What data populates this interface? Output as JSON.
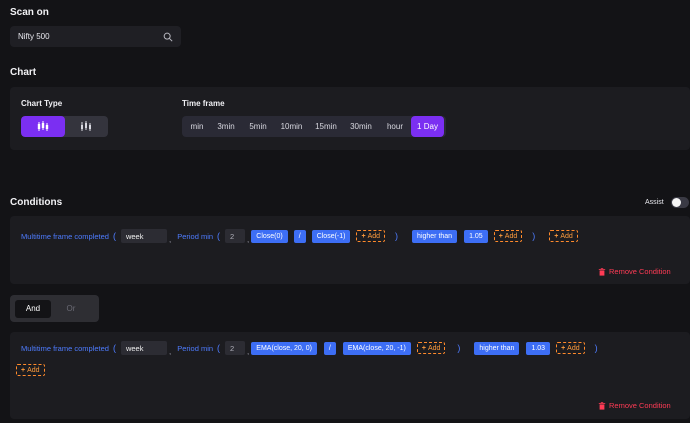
{
  "scan": {
    "title": "Scan on",
    "value": "Nifty 500"
  },
  "chart": {
    "title": "Chart",
    "chart_type_label": "Chart Type",
    "chart_types": [
      "candlestick",
      "ohlc-bar"
    ],
    "active_chart_type": "candlestick",
    "timeframe_label": "Time frame",
    "timeframes": [
      "min",
      "3min",
      "5min",
      "10min",
      "15min",
      "30min",
      "hour",
      "1 Day"
    ],
    "active_timeframe": "1 Day"
  },
  "conditions": {
    "title": "Conditions",
    "assist_label": "Assist",
    "assist_on": false,
    "remove_label": "Remove Condition",
    "add_label": "Add",
    "condition_1": {
      "link": "Multitime frame completed",
      "timeframe": "week",
      "period_link": "Period min",
      "period": "2",
      "lhs": "Close(0)",
      "op": "/",
      "rhs": "Close(-1)",
      "compare": "higher than",
      "value": "1.05"
    },
    "condition_2": {
      "link": "Multitime frame completed",
      "timeframe": "week",
      "period_link": "Period min",
      "period": "2",
      "lhs": "EMA(close, 20, 0)",
      "op": "/",
      "rhs": "EMA(close, 20, -1)",
      "compare": "higher than",
      "value": "1.03"
    },
    "logic": {
      "and_label": "And",
      "or_label": "Or",
      "active": "And"
    }
  },
  "colors": {
    "background": "#131316",
    "panel": "#1c1c20",
    "accent": "#7b2ff2",
    "link": "#4e7cff",
    "pill": "#3d6ef5",
    "add": "#ff8a2b",
    "remove": "#ff3b55"
  }
}
